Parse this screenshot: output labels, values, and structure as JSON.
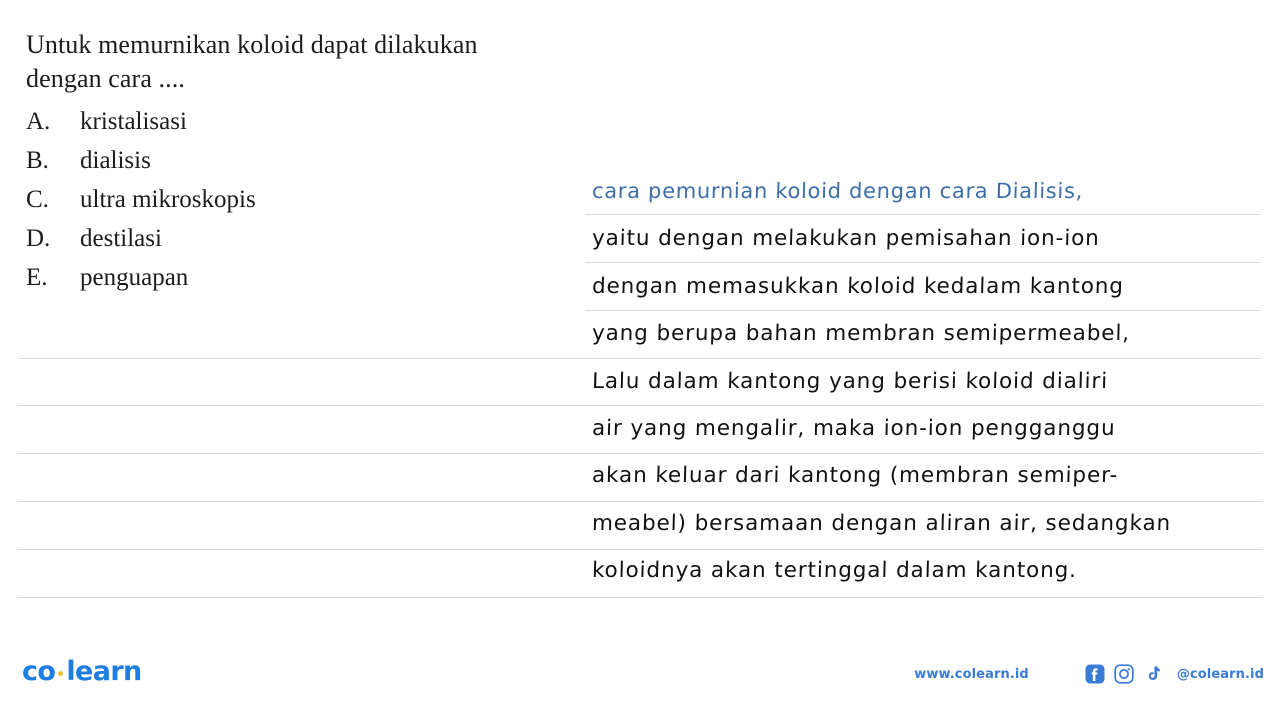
{
  "question": {
    "stem_lines": [
      "Untuk memurnikan koloid dapat dilakukan",
      "dengan cara ...."
    ],
    "options": [
      {
        "letter": "A.",
        "text": "kristalisasi"
      },
      {
        "letter": "B.",
        "text": "dialisis"
      },
      {
        "letter": "C.",
        "text": "ultra mikroskopis"
      },
      {
        "letter": "D.",
        "text": "destilasi"
      },
      {
        "letter": "E.",
        "text": "penguapan"
      }
    ]
  },
  "answer": {
    "lines": [
      {
        "text": "cara pemurnian koloid dengan cara Dialisis,",
        "color": "#3d6ea8"
      },
      {
        "text": "yaitu dengan melakukan pemisahan ion-ion",
        "color": "#111111"
      },
      {
        "text": "dengan memasukkan koloid kedalam kantong",
        "color": "#111111"
      },
      {
        "text": "yang berupa bahan membran semipermeabel,",
        "color": "#111111"
      },
      {
        "text": "Lalu dalam kantong yang berisi koloid dialiri",
        "color": "#111111"
      },
      {
        "text": "air yang mengalir, maka ion-ion pengganggu",
        "color": "#111111"
      },
      {
        "text": "akan keluar dari kantong (membran semiper-",
        "color": "#111111"
      },
      {
        "text": "meabel) bersamaan dengan aliran air, sedangkan",
        "color": "#111111"
      },
      {
        "text": "koloidnya akan tertinggal dalam kantong.",
        "color": "#111111"
      }
    ]
  },
  "footer": {
    "logo_part1": "co",
    "logo_part2": "learn",
    "site_url": "www.colearn.id",
    "social_handle": "@colearn.id",
    "socials": [
      "facebook-icon",
      "instagram-icon",
      "tiktok-icon"
    ]
  },
  "colors": {
    "brand_blue": "#1f7de0",
    "brand_dot": "#f2c230",
    "footer_blue": "#3a7bd5",
    "handwriting_accent": "#3d6ea8",
    "handwriting_ink": "#111111",
    "rule": "#d8d8d8"
  }
}
